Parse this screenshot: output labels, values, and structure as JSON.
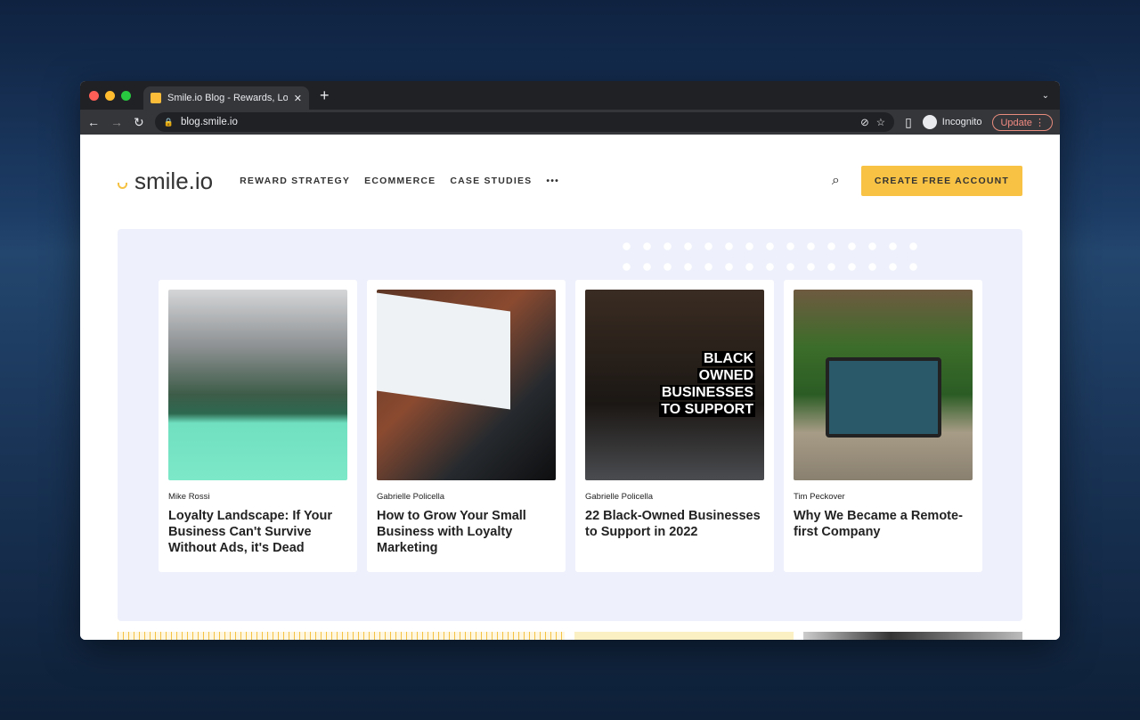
{
  "browser": {
    "tab_title": "Smile.io Blog - Rewards, Loyalty",
    "url": "blog.smile.io",
    "profile": "Incognito",
    "update_label": "Update"
  },
  "site": {
    "logo": "smile.io",
    "nav": [
      "REWARD STRATEGY",
      "ECOMMERCE",
      "CASE STUDIES"
    ],
    "more": "•••",
    "cta": "CREATE FREE ACCOUNT"
  },
  "posts": [
    {
      "author": "Mike Rossi",
      "title": "Loyalty Landscape: If Your Business Can't Survive Without Ads, it's Dead"
    },
    {
      "author": "Gabrielle Policella",
      "title": "How to Grow Your Small Business with Loyalty Marketing"
    },
    {
      "author": "Gabrielle Policella",
      "title": "22 Black-Owned Businesses to Support in 2022",
      "image_text": [
        "BLACK",
        "OWNED",
        "BUSINESSES",
        "TO SUPPORT"
      ]
    },
    {
      "author": "Tim Peckover",
      "title": "Why We Became a Remote-first Company"
    }
  ]
}
